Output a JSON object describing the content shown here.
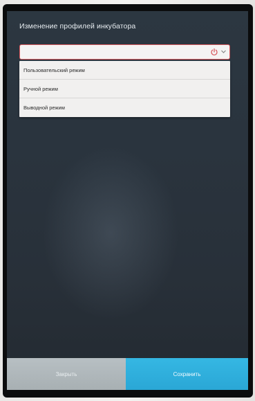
{
  "header": {
    "title": "Изменение профилей инкубатора"
  },
  "profile_select": {
    "selected_value": "",
    "icons": [
      "power-icon",
      "chevron-down-icon"
    ],
    "accent_color": "#d9595e",
    "options": [
      {
        "label": "Пользовательский режим"
      },
      {
        "label": "Ручной режим"
      },
      {
        "label": "Выводной режим"
      }
    ]
  },
  "footer": {
    "close_label": "Закрыть",
    "save_label": "Сохранить",
    "save_color": "#2fb0de"
  }
}
